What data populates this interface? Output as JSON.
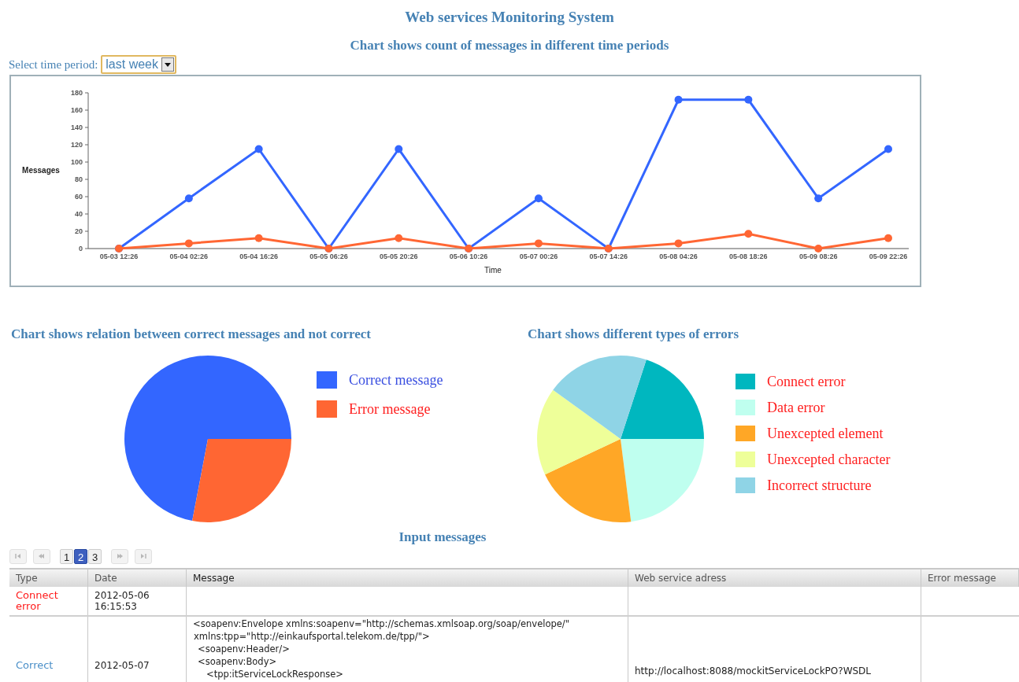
{
  "title": "Web services Monitoring System",
  "line_section": {
    "heading": "Chart shows count of messages in different time periods",
    "select_label": "Select time period:",
    "select_value": "last week",
    "chart_data": {
      "type": "line",
      "xlabel": "Time",
      "ylabel": "Messages",
      "categories": [
        "05-03 12:26",
        "05-04 02:26",
        "05-04 16:26",
        "05-05 06:26",
        "05-05 20:26",
        "05-06 10:26",
        "05-07 00:26",
        "05-07 14:26",
        "05-08 04:26",
        "05-08 18:26",
        "05-09 08:26",
        "05-09 22:26"
      ],
      "ylim": [
        0,
        180
      ],
      "yticks": [
        0,
        20,
        40,
        60,
        80,
        100,
        120,
        140,
        160,
        180
      ],
      "series": [
        {
          "color": "#3366ff",
          "marker": "circle",
          "values": [
            0,
            58,
            115,
            0,
            115,
            0,
            58,
            0,
            172,
            172,
            58,
            115
          ]
        },
        {
          "color": "#ff6633",
          "marker": "circle",
          "values": [
            0,
            6,
            12,
            0,
            12,
            0,
            6,
            0,
            6,
            17,
            0,
            12
          ]
        }
      ]
    }
  },
  "pies": [
    {
      "heading": "Chart shows relation between correct messages and not correct",
      "legend_labels": [
        {
          "color": "#3a4fe0"
        },
        {
          "color": "#ff2020"
        }
      ],
      "chart_data": {
        "type": "pie",
        "categories": [
          "Correct message",
          "Error message"
        ],
        "values": [
          72,
          28
        ],
        "colors": [
          "#3366ff",
          "#ff6633"
        ]
      }
    },
    {
      "heading": "Chart shows different types of errors",
      "legend_labels": [
        {
          "color": "#ff2020"
        },
        {
          "color": "#ff2020"
        },
        {
          "color": "#ff2020"
        },
        {
          "color": "#ff2020"
        },
        {
          "color": "#ff2020"
        }
      ],
      "chart_data": {
        "type": "pie",
        "categories": [
          "Connect error",
          "Data error",
          "Unexcepted element",
          "Unexcepted character",
          "Incorrect structure"
        ],
        "values": [
          20,
          23,
          20,
          17,
          20
        ],
        "colors": [
          "#00b7bf",
          "#bfffef",
          "#ffa726",
          "#eeff99",
          "#8fd4e6"
        ]
      }
    }
  ],
  "messages": {
    "heading": "Input messages",
    "pager": {
      "nav_first": {
        "disabled": true
      },
      "nav_prev": {
        "disabled": true
      },
      "pages": [
        {
          "label": "1",
          "selected": false
        },
        {
          "label": "2",
          "selected": true
        },
        {
          "label": "3",
          "selected": false
        }
      ],
      "nav_next": {
        "disabled": true
      },
      "nav_last": {
        "disabled": true
      }
    },
    "columns": [
      "Type",
      "Date",
      "Message",
      "Web service adress",
      "Error message"
    ],
    "rows": [
      {
        "type": "Connect error",
        "kind": "error",
        "date": [
          "2012-05-06",
          "16:15:53"
        ]
      },
      {
        "type": "Correct",
        "kind": "correct",
        "date": [
          "2012-05-07"
        ],
        "message": [
          "<soapenv:Envelope xmlns:soapenv=\"http://schemas.xmlsoap.org/soap/envelope/\"",
          "xmlns:tpp=\"http://einkaufsportal.telekom.de/tpp/\">",
          "<soapenv:Header/>",
          "<soapenv:Body>",
          "<tpp:itServiceLockResponse>"
        ],
        "address": "http://localhost:8088/mockitServiceLockPO?WSDL"
      }
    ]
  }
}
